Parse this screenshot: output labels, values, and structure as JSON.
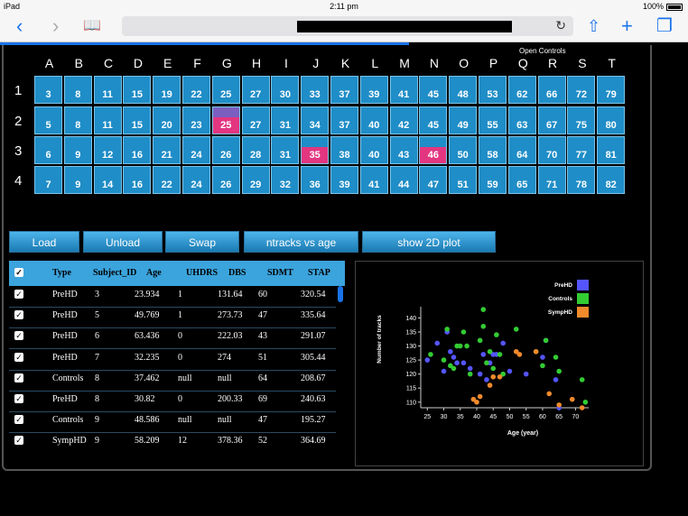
{
  "status": {
    "device": "iPad",
    "time": "2:11 pm",
    "battery": "100%"
  },
  "toolbar": {
    "back": "‹",
    "forward": "›",
    "bookmarks": "📖",
    "reload": "↻",
    "share": "⇧",
    "add": "+",
    "tabs": "❐"
  },
  "open_controls": "Open Controls",
  "columns": [
    "A",
    "B",
    "C",
    "D",
    "E",
    "F",
    "G",
    "H",
    "I",
    "J",
    "K",
    "L",
    "M",
    "N",
    "O",
    "P",
    "Q",
    "R",
    "S",
    "T"
  ],
  "rows": [
    {
      "label": "1",
      "cells": [
        "3",
        "8",
        "11",
        "15",
        "19",
        "22",
        "25",
        "27",
        "30",
        "33",
        "37",
        "39",
        "41",
        "45",
        "48",
        "53",
        "62",
        "66",
        "72",
        "79"
      ]
    },
    {
      "label": "2",
      "cells": [
        "5",
        "8",
        "11",
        "15",
        "20",
        "23",
        "25",
        "27",
        "31",
        "34",
        "37",
        "40",
        "42",
        "45",
        "49",
        "55",
        "63",
        "67",
        "75",
        "80"
      ]
    },
    {
      "label": "3",
      "cells": [
        "6",
        "9",
        "12",
        "16",
        "21",
        "24",
        "26",
        "28",
        "31",
        "35",
        "38",
        "40",
        "43",
        "46",
        "50",
        "58",
        "64",
        "70",
        "77",
        "81"
      ]
    },
    {
      "label": "4",
      "cells": [
        "7",
        "9",
        "14",
        "16",
        "22",
        "24",
        "26",
        "29",
        "32",
        "36",
        "39",
        "41",
        "44",
        "47",
        "51",
        "59",
        "65",
        "71",
        "78",
        "82"
      ]
    }
  ],
  "buttons": {
    "load": "Load",
    "unload": "Unload",
    "swap": "Swap",
    "ntracks": "ntracks vs age",
    "plot2d": "show 2D plot"
  },
  "table": {
    "headers": [
      "Type",
      "Subject_ID",
      "Age",
      "UHDRS",
      "DBS",
      "SDMT",
      "STAP"
    ],
    "rows": [
      [
        "PreHD",
        "3",
        "23.934",
        "1",
        "131.64",
        "60",
        "320.54"
      ],
      [
        "PreHD",
        "5",
        "49.769",
        "1",
        "273.73",
        "47",
        "335.64"
      ],
      [
        "PreHD",
        "6",
        "63.436",
        "0",
        "222.03",
        "43",
        "291.07"
      ],
      [
        "PreHD",
        "7",
        "32.235",
        "0",
        "274",
        "51",
        "305.44"
      ],
      [
        "Controls",
        "8",
        "37.462",
        "null",
        "null",
        "64",
        "208.67"
      ],
      [
        "PreHD",
        "8",
        "30.82",
        "0",
        "200.33",
        "69",
        "240.63"
      ],
      [
        "Controls",
        "9",
        "48.586",
        "null",
        "null",
        "47",
        "195.27"
      ],
      [
        "SympHD",
        "9",
        "58.209",
        "12",
        "378.36",
        "52",
        "364.69"
      ]
    ]
  },
  "chart_data": {
    "type": "scatter",
    "xlabel": "Age (year)",
    "ylabel": "Number of tracks",
    "xlim": [
      23,
      74
    ],
    "ylim": [
      108,
      144
    ],
    "xticks": [
      "25",
      "30",
      "35",
      "40",
      "45",
      "50",
      "55",
      "60",
      "65",
      "70"
    ],
    "yticks": [
      "110",
      "115",
      "120",
      "125",
      "130",
      "135",
      "140"
    ],
    "legend_position": "top-right",
    "series": [
      {
        "name": "PreHD",
        "color": "#5555ff",
        "points": [
          [
            25,
            125
          ],
          [
            28,
            131
          ],
          [
            30,
            121
          ],
          [
            31,
            135
          ],
          [
            32,
            128
          ],
          [
            33,
            126
          ],
          [
            34,
            124
          ],
          [
            36,
            124
          ],
          [
            38,
            122
          ],
          [
            41,
            120
          ],
          [
            42,
            127
          ],
          [
            43,
            118
          ],
          [
            44,
            124
          ],
          [
            45,
            127
          ],
          [
            46,
            127
          ],
          [
            48,
            131
          ],
          [
            50,
            121
          ],
          [
            55,
            120
          ],
          [
            60,
            126
          ],
          [
            61,
            132
          ],
          [
            64,
            118
          ],
          [
            65,
            108
          ]
        ]
      },
      {
        "name": "Controls",
        "color": "#33cc33",
        "points": [
          [
            26,
            127
          ],
          [
            30,
            125
          ],
          [
            31,
            136
          ],
          [
            32,
            123
          ],
          [
            33,
            122
          ],
          [
            34,
            130
          ],
          [
            35,
            130
          ],
          [
            36,
            135
          ],
          [
            37,
            130
          ],
          [
            38,
            120
          ],
          [
            41,
            132
          ],
          [
            42,
            137
          ],
          [
            42,
            143
          ],
          [
            43,
            124
          ],
          [
            44,
            128
          ],
          [
            45,
            122
          ],
          [
            46,
            134
          ],
          [
            47,
            127
          ],
          [
            48,
            120
          ],
          [
            52,
            136
          ],
          [
            58,
            128
          ],
          [
            60,
            123
          ],
          [
            61,
            132
          ],
          [
            64,
            126
          ],
          [
            65,
            121
          ],
          [
            72,
            118
          ],
          [
            73,
            110
          ]
        ]
      },
      {
        "name": "SympHD",
        "color": "#f08a2c",
        "points": [
          [
            39,
            111
          ],
          [
            40,
            110
          ],
          [
            41,
            112
          ],
          [
            44,
            116
          ],
          [
            45,
            119
          ],
          [
            47,
            119
          ],
          [
            52,
            128
          ],
          [
            53,
            127
          ],
          [
            58,
            128
          ],
          [
            62,
            113
          ],
          [
            65,
            109
          ],
          [
            69,
            111
          ],
          [
            72,
            108
          ]
        ]
      }
    ]
  }
}
